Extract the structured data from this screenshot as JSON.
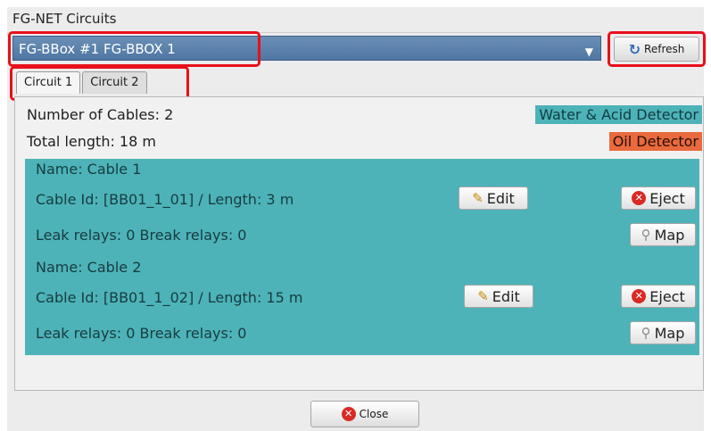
{
  "window": {
    "title": "FG-NET Circuits"
  },
  "selector": {
    "value": "FG-BBox #1 FG-BBOX 1",
    "arrow_icon": "chevron-down-icon"
  },
  "toolbar": {
    "refresh_label": "Refresh",
    "refresh_icon": "refresh-icon"
  },
  "tabs": [
    {
      "label": "Circuit 1",
      "active": true
    },
    {
      "label": "Circuit 2",
      "active": false
    }
  ],
  "summary": {
    "cables": "Number of Cables: 2",
    "length": "Total length: 18 m",
    "water_badge": "Water & Acid Detector",
    "oil_badge": "Oil Detector",
    "water_color": "#4db3b8",
    "oil_color": "#e86a3d"
  },
  "cables": [
    {
      "name": "Name: Cable 1",
      "details": "Cable Id: [BB01_1_01] / Length: 3 m",
      "relays": "Leak relays: 0  Break relays: 0",
      "edit_label": "Edit",
      "eject_label": "Eject",
      "map_label": "Map"
    },
    {
      "name": "Name: Cable 2",
      "details": "Cable Id: [BB01_1_02] / Length: 15 m",
      "relays": "Leak relays: 0  Break relays: 0",
      "edit_label": "Edit",
      "eject_label": "Eject",
      "map_label": "Map"
    }
  ],
  "footer": {
    "close_label": "Close"
  },
  "colors": {
    "highlight": "#e8101a",
    "selection": "#5a80ab"
  }
}
